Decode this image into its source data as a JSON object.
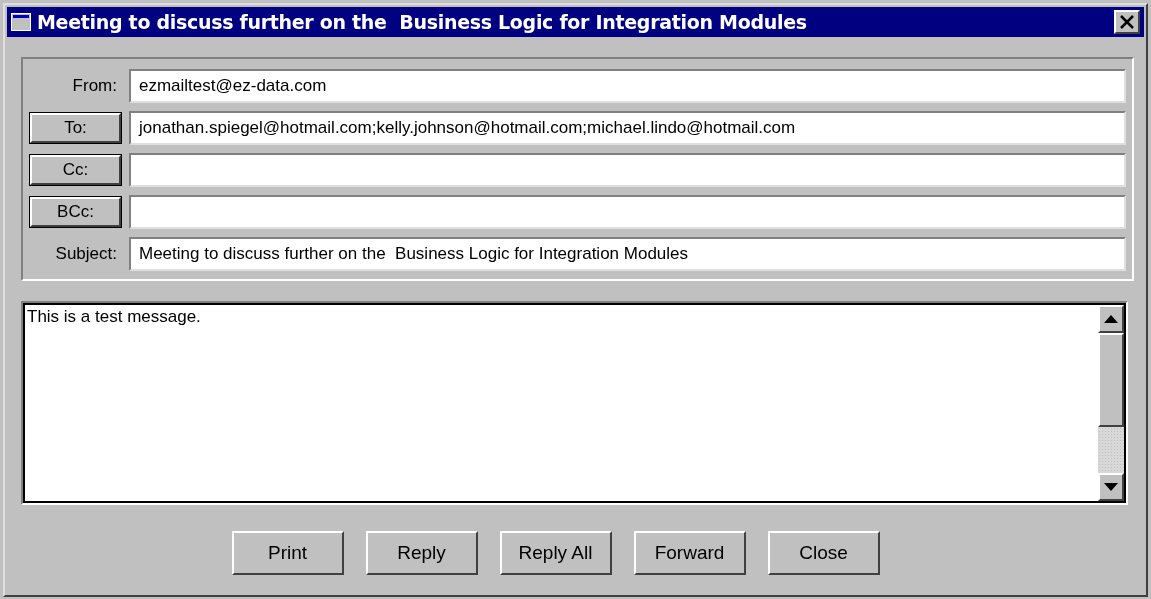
{
  "window": {
    "title": "Meeting to discuss further on the  Business Logic for Integration Modules"
  },
  "header_fields": [
    {
      "kind": "label",
      "label": "From:",
      "value": "ezmailtest@ez-data.com"
    },
    {
      "kind": "button",
      "label": "To:",
      "value": "jonathan.spiegel@hotmail.com;kelly.johnson@hotmail.com;michael.lindo@hotmail.com"
    },
    {
      "kind": "button",
      "label": "Cc:"
    },
    {
      "kind": "button",
      "label": "BCc:"
    },
    {
      "kind": "label",
      "label": "Subject:",
      "value": "Meeting to discuss further on the  Business Logic for Integration Modules"
    }
  ],
  "body": {
    "text": "This is a test message."
  },
  "buttons": [
    "Print",
    "Reply",
    "Reply All",
    "Forward",
    "Close"
  ]
}
